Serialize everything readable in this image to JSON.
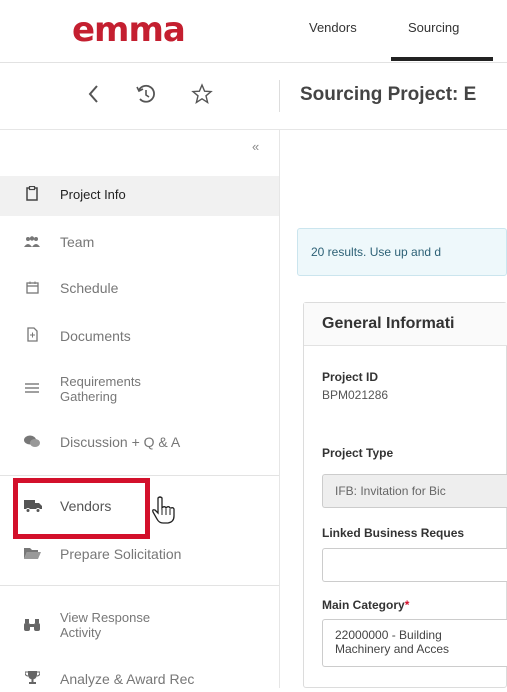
{
  "logo": {
    "text": "emma"
  },
  "nav": {
    "tabs": [
      {
        "label": "Vendors"
      },
      {
        "label": "Sourcing",
        "active": true
      }
    ]
  },
  "toolbar": {
    "back_icon": "chevron-left-icon",
    "history_icon": "history-icon",
    "favorite_icon": "star-outline-icon",
    "title": "Sourcing Project: E"
  },
  "sidebar": {
    "collapse_label": "«",
    "items": [
      {
        "label": "Project Info",
        "icon": "clipboard-icon",
        "active": true
      },
      {
        "label": "Team",
        "icon": "team-icon"
      },
      {
        "label": "Schedule",
        "icon": "calendar-icon"
      },
      {
        "label": "Documents",
        "icon": "document-icon"
      },
      {
        "label": "Requirements\nGathering",
        "icon": "list-icon"
      },
      {
        "label": "Discussion + Q & A",
        "icon": "discussion-icon"
      },
      {
        "label": "Vendors",
        "icon": "truck-icon"
      },
      {
        "label": "Prepare Solicitation",
        "icon": "folder-open-icon"
      },
      {
        "label": "View Response\nActivity",
        "icon": "binoculars-icon"
      },
      {
        "label": "Analyze & Award Rec",
        "icon": "trophy-icon"
      }
    ]
  },
  "main": {
    "results_text": "20 results. Use up and d",
    "card_title": "General Informati",
    "fields": {
      "project_id_label": "Project ID",
      "project_id_value": "BPM021286",
      "project_type_label": "Project Type",
      "project_type_value": "IFB: Invitation for Bic",
      "linked_label": "Linked Business Reques",
      "linked_value": "",
      "main_category_label": "Main Category",
      "main_category_required": "*",
      "main_category_value_line1": "22000000 - Building",
      "main_category_value_line2": "Machinery and Acces"
    }
  },
  "colors": {
    "brand_red": "#c41f30",
    "highlight": "#d3102b",
    "info_bg": "#eef8fb"
  }
}
